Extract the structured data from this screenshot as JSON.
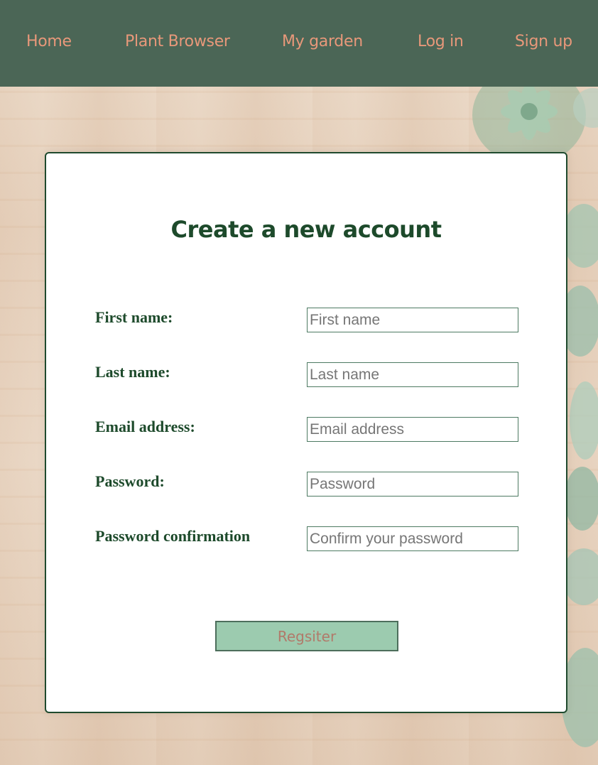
{
  "nav": {
    "home": "Home",
    "plant_browser": "Plant Browser",
    "my_garden": "My garden",
    "log_in": "Log in",
    "sign_up": "Sign up"
  },
  "form": {
    "title": "Create a new account",
    "fields": [
      {
        "label": "First name:",
        "placeholder": "First name",
        "value": ""
      },
      {
        "label": "Last name:",
        "placeholder": "Last name",
        "value": ""
      },
      {
        "label": "Email address:",
        "placeholder": "Email address",
        "value": ""
      },
      {
        "label": "Password:",
        "placeholder": "Password",
        "value": ""
      },
      {
        "label": "Password confirmation",
        "placeholder": "Confirm your password",
        "value": ""
      }
    ],
    "submit_label": "Regsiter"
  },
  "colors": {
    "navbar": "#4b6656",
    "nav_link": "#e8987a",
    "heading": "#1d4a2b",
    "button_bg": "#9ccbaf",
    "button_text": "#b17a6a"
  }
}
